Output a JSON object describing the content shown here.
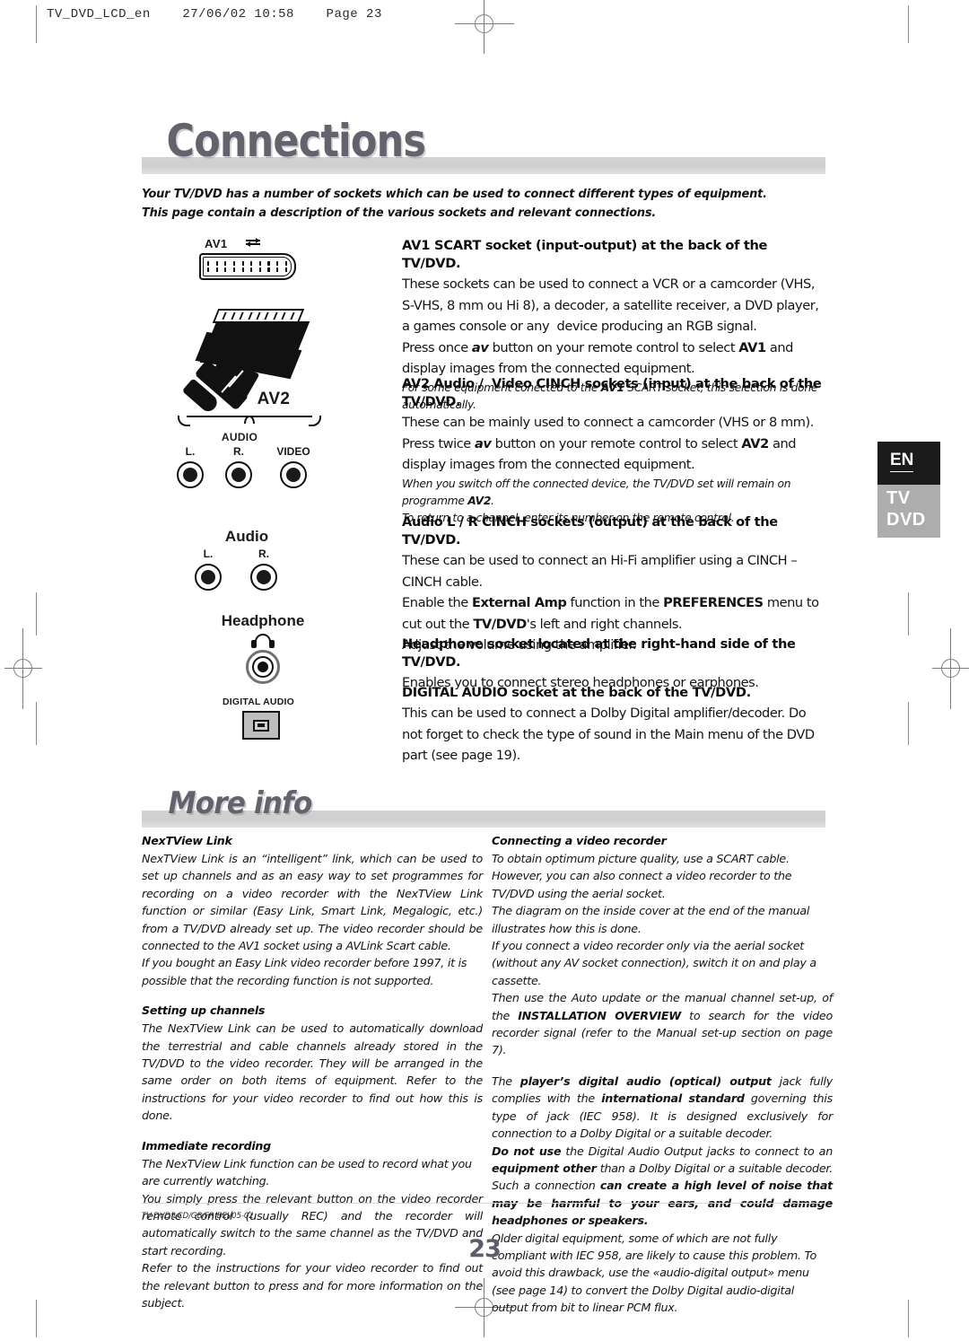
{
  "print_header": "TV_DVD_LCD_en    27/06/02 10:58    Page 23",
  "banners": {
    "connections": "Connections",
    "more_info": "More info"
  },
  "intro": {
    "line1": "Your TV/DVD has a number of sockets which can be used to connect different types of equipment.",
    "line2": "This page contain a description of the various sockets and relevant connections."
  },
  "lang_tab": {
    "language": "EN",
    "tv": "TV",
    "dvd": "DVD"
  },
  "diagram": {
    "av1_label": "AV1",
    "av1_arrows_icon": "bidirectional-arrows-icon",
    "scart_socket_icon": "scart-socket-icon",
    "scart_plug_icon": "scart-plug-icon",
    "av2_label": "AV2",
    "av2_audio_caption": "AUDIO",
    "av2_left": "L.",
    "av2_right": "R.",
    "av2_video": "VIDEO",
    "audio_label": "Audio",
    "audio_left": "L.",
    "audio_right": "R.",
    "headphone_label": "Headphone",
    "headphone_icon": "headphone-icon",
    "digital_audio_label": "DIGITAL AUDIO",
    "digital_audio_icon": "optical-socket-icon"
  },
  "sections": [
    {
      "id": "av1",
      "heading": "AV1 SCART socket (input-output) at the back of the TV/DVD.",
      "paragraphs": [
        "These sockets can be used to connect a VCR or a camcorder (VHS, S-VHS, 8 mm ou Hi 8), a decoder, a satellite receiver, a DVD player, a games console or any  device producing an RGB signal.",
        "Press once av button on your remote control to select AV1 and display images from the connected equipment."
      ],
      "note": "For some equipment conected to the AV1 SCART socket, this selection is done automatically."
    },
    {
      "id": "av2",
      "heading": "AV2 Audio /  Video CINCH sockets (input) at the back of the TV/DVD.",
      "paragraphs": [
        "These can be mainly used to connect a camcorder (VHS or 8 mm).",
        "Press twice av button on your remote control to select AV2 and display images from the connected equipment."
      ],
      "notes": [
        "When you switch off the connected device, the TV/DVD set will remain on programme AV2.",
        "To return to a channel, enter its number on the remote control."
      ]
    },
    {
      "id": "audio-lr",
      "heading": "Audio L / R CINCH sockets (output) at the back of the TV/DVD.",
      "paragraphs": [
        "These can be used to connect an Hi-Fi amplifier using a CINCH – CINCH cable.",
        "Enable the External Amp function in the PREFERENCES menu to cut out the TV/DVD's left and right channels.",
        "Adjust the volume using the amplifier."
      ]
    },
    {
      "id": "headphone",
      "heading": "Headphone socket located at the right-hand side of the TV/DVD.",
      "paragraphs": [
        "Enables you to connect stereo headphones or earphones."
      ]
    },
    {
      "id": "digital-audio",
      "heading": "DIGITAL AUDIO socket at the back of the TV/DVD.",
      "paragraphs": [
        "This can be used to connect a Dolby Digital amplifier/decoder. Do not forget to check the type of sound in the Main menu of the DVD part (see page 19)."
      ]
    }
  ],
  "more_info": {
    "left": [
      {
        "title": "NexTView Link",
        "paragraphs": [
          "NexTView Link is an “intelligent” link, which can be used to set up channels and as an easy way to set programmes for recording on a video recorder with the NexTView Link function or similar (Easy Link, Smart Link, Megalogic, etc.) from a TV/DVD already set up. The video recorder should be connected to the AV1 socket using a AVLink Scart cable.",
          "If you bought an Easy Link video recorder before 1997, it is possible that the recording function is not supported."
        ]
      },
      {
        "title": "Setting up channels",
        "paragraphs": [
          "The NexTView Link can be used to automatically download the terrestrial and cable channels already stored in the TV/DVD to the video recorder. They will be arranged in the same order on both items of equipment. Refer to the instructions for your video recorder to find out how this is done."
        ]
      },
      {
        "title": "Immediate recording",
        "paragraphs": [
          "The NexTView Link function can be used to record what you are currently watching.",
          "You simply press the relevant button on the video recorder remote control (usually REC) and the recorder will automatically switch to the same channel as the TV/DVD and start recording.",
          "Refer to the instructions for your video recorder to find out the relevant button to press and for more information on the subject."
        ]
      }
    ],
    "right": [
      {
        "title": "Connecting a video recorder",
        "paragraphs": [
          "To obtain optimum picture quality, use a SCART cable. However, you can also connect a video recorder to the TV/DVD using the aerial socket.",
          "The diagram on the inside cover at the end of the manual illustrates how this is done.",
          "If you connect a video recorder only via the aerial socket (without any AV socket connection), switch it on and play a cassette."
        ],
        "rich_paragraph_1": "Then use the Auto update or the manual channel set-up, of the INSTALLATION OVERVIEW to search for the video recorder signal (refer to the Manual set-up section on page 7)."
      },
      {
        "rich_paragraph_2": "The player’s digital audio (optical) output jack fully complies with the international standard governing this type of jack (IEC 958). It is designed exclusively for connection to a Dolby Digital or a suitable decoder.",
        "rich_paragraph_3": "Do not use the Digital Audio Output jacks to connect to an equipment other than a Dolby Digital or a suitable decoder. Such a connection can create a high level of noise that may be harmful to your ears, and could damage headphones or speakers.",
        "rich_paragraph_4": "Older digital equipment, some of which are not fully compliant with IEC 958, are likely to cause this problem. To avoid this drawback, use the «audio-digital output» menu (see page 14) to convert the Dolby Digital audio-digital output from bit to linear PCM flux."
      }
    ]
  },
  "footer": {
    "code": "TV-DVD-LCD/GB/FR-BEI/05-02",
    "page_number": "23"
  }
}
